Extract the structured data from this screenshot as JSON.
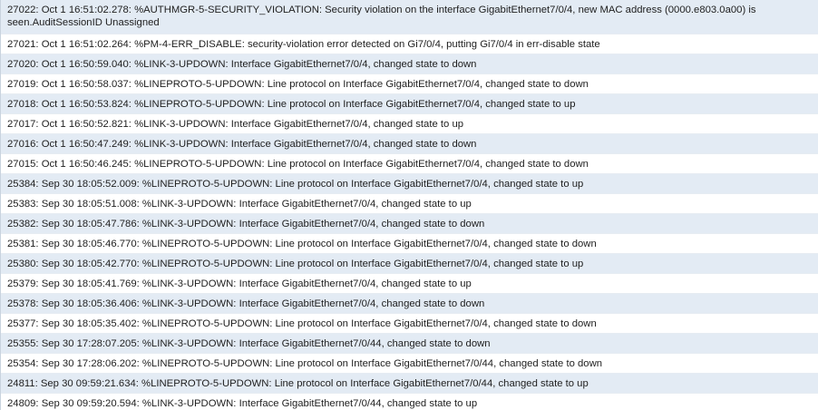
{
  "log": {
    "rows": [
      "27022: Oct 1 16:51:02.278: %AUTHMGR-5-SECURITY_VIOLATION: Security violation on the interface GigabitEthernet7/0/4, new MAC address (0000.e803.0a00) is seen.AuditSessionID Unassigned",
      "27021: Oct 1 16:51:02.264: %PM-4-ERR_DISABLE: security-violation error detected on Gi7/0/4, putting Gi7/0/4 in err-disable state",
      "27020: Oct 1 16:50:59.040: %LINK-3-UPDOWN: Interface GigabitEthernet7/0/4, changed state to down",
      "27019: Oct 1 16:50:58.037: %LINEPROTO-5-UPDOWN: Line protocol on Interface GigabitEthernet7/0/4, changed state to down",
      "27018: Oct 1 16:50:53.824: %LINEPROTO-5-UPDOWN: Line protocol on Interface GigabitEthernet7/0/4, changed state to up",
      "27017: Oct 1 16:50:52.821: %LINK-3-UPDOWN: Interface GigabitEthernet7/0/4, changed state to up",
      "27016: Oct 1 16:50:47.249: %LINK-3-UPDOWN: Interface GigabitEthernet7/0/4, changed state to down",
      "27015: Oct 1 16:50:46.245: %LINEPROTO-5-UPDOWN: Line protocol on Interface GigabitEthernet7/0/4, changed state to down",
      "25384: Sep 30 18:05:52.009: %LINEPROTO-5-UPDOWN: Line protocol on Interface GigabitEthernet7/0/4, changed state to up",
      "25383: Sep 30 18:05:51.008: %LINK-3-UPDOWN: Interface GigabitEthernet7/0/4, changed state to up",
      "25382: Sep 30 18:05:47.786: %LINK-3-UPDOWN: Interface GigabitEthernet7/0/4, changed state to down",
      "25381: Sep 30 18:05:46.770: %LINEPROTO-5-UPDOWN: Line protocol on Interface GigabitEthernet7/0/4, changed state to down",
      "25380: Sep 30 18:05:42.770: %LINEPROTO-5-UPDOWN: Line protocol on Interface GigabitEthernet7/0/4, changed state to up",
      "25379: Sep 30 18:05:41.769: %LINK-3-UPDOWN: Interface GigabitEthernet7/0/4, changed state to up",
      "25378: Sep 30 18:05:36.406: %LINK-3-UPDOWN: Interface GigabitEthernet7/0/4, changed state to down",
      "25377: Sep 30 18:05:35.402: %LINEPROTO-5-UPDOWN: Line protocol on Interface GigabitEthernet7/0/4, changed state to down",
      "25355: Sep 30 17:28:07.205: %LINK-3-UPDOWN: Interface GigabitEthernet7/0/44, changed state to down",
      "25354: Sep 30 17:28:06.202: %LINEPROTO-5-UPDOWN: Line protocol on Interface GigabitEthernet7/0/44, changed state to down",
      "24811: Sep 30 09:59:21.634: %LINEPROTO-5-UPDOWN: Line protocol on Interface GigabitEthernet7/0/44, changed state to up",
      "24809: Sep 30 09:59:20.594: %LINK-3-UPDOWN: Interface GigabitEthernet7/0/44, changed state to up"
    ]
  }
}
